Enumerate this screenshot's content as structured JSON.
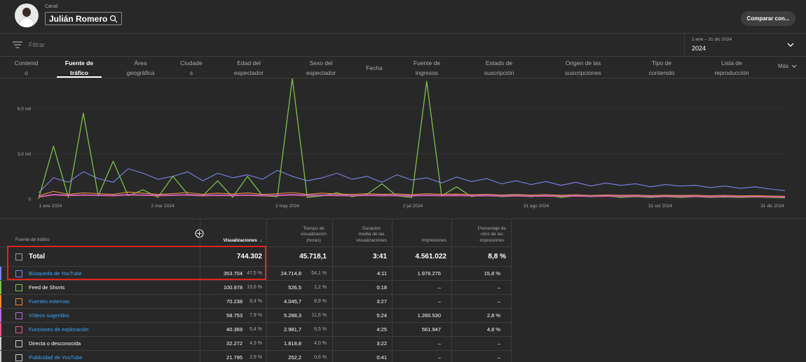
{
  "header": {
    "channel_label": "Canal",
    "channel_name": "Julián Romero",
    "compare_label": "Comparar con..."
  },
  "filter": {
    "placeholder": "Filtrar",
    "date_range": "1 ene – 31 dic 2024",
    "year": "2024"
  },
  "tabs": [
    {
      "line1": "Contenid",
      "line2": "o"
    },
    {
      "line1": "Fuente de",
      "line2": "tráfico"
    },
    {
      "line1": "Área",
      "line2": "geográfica"
    },
    {
      "line1": "Ciudade",
      "line2": "s"
    },
    {
      "line1": "Edad del",
      "line2": "espectador"
    },
    {
      "line1": "Sexo del",
      "line2": "espectador"
    },
    {
      "line1": "Fecha",
      "line2": ""
    },
    {
      "line1": "Fuente de",
      "line2": "ingresos"
    },
    {
      "line1": "Estado de",
      "line2": "suscripción"
    },
    {
      "line1": "Origen de las",
      "line2": "suscripciones"
    },
    {
      "line1": "Tipo de",
      "line2": "contenido"
    },
    {
      "line1": "Lista de",
      "line2": "reproducción"
    }
  ],
  "more_label": "Más",
  "chart_data": {
    "type": "line",
    "y_ticks": [
      "6,0 mil",
      "3,0 mil",
      "0"
    ],
    "ylim": [
      0,
      8000
    ],
    "x_ticks": [
      "1 ene 2024",
      "2 mar 2024",
      "2 may 2024",
      "2 jul 2024",
      "31 ago 2024",
      "31 oct 2024",
      "31 dic 2024"
    ],
    "series": [
      {
        "color": "#7b83eb",
        "values": [
          400,
          1400,
          1100,
          1800,
          1350,
          1100,
          2000,
          1700,
          1300,
          1500,
          1800,
          1200,
          1700,
          1400,
          1600,
          1300,
          1900,
          1500,
          1200,
          1400,
          1700,
          1300,
          1500,
          1100,
          1600,
          1250,
          1400,
          1050,
          1450,
          1150,
          1350,
          1000,
          1200,
          950,
          1150,
          900,
          1100,
          850,
          1050,
          900,
          1000,
          800,
          950,
          850,
          900,
          750,
          850,
          700,
          800,
          650,
          550
        ]
      },
      {
        "color": "#7cc04b",
        "values": [
          0,
          3500,
          100,
          5700,
          200,
          2500,
          200,
          600,
          100,
          1500,
          300,
          200,
          1200,
          100,
          1500,
          200,
          150,
          8000,
          100,
          200,
          400,
          150,
          300,
          1000,
          200,
          100,
          7800,
          200,
          800,
          150,
          300,
          150,
          200,
          150,
          250,
          100,
          200,
          150,
          200,
          100,
          150,
          100,
          150,
          100,
          150,
          100,
          120,
          100,
          120,
          100,
          80
        ]
      },
      {
        "color": "#e8883a",
        "values": [
          200,
          500,
          300,
          400,
          350,
          300,
          450,
          380,
          300,
          350,
          420,
          300,
          380,
          320,
          400,
          300,
          350,
          420,
          300,
          380,
          320,
          300,
          350,
          300,
          330,
          280,
          350,
          300,
          320,
          280,
          300,
          260,
          290,
          250,
          280,
          240,
          270,
          230,
          260,
          240,
          250,
          220,
          240,
          230,
          240,
          210,
          230,
          200,
          220,
          190,
          170
        ]
      },
      {
        "color": "#b36dd9",
        "values": [
          150,
          300,
          250,
          280,
          260,
          240,
          300,
          280,
          250,
          270,
          300,
          240,
          270,
          250,
          280,
          240,
          260,
          300,
          250,
          270,
          260,
          240,
          270,
          250,
          260,
          230,
          270,
          240,
          260,
          230,
          250,
          220,
          240,
          210,
          230,
          200,
          220,
          200,
          210,
          190,
          200,
          180,
          190,
          180,
          190,
          170,
          180,
          160,
          170,
          150,
          140
        ]
      },
      {
        "color": "#e05a8a",
        "values": [
          100,
          250,
          200,
          230,
          210,
          190,
          240,
          220,
          200,
          210,
          230,
          190,
          210,
          200,
          220,
          190,
          200,
          240,
          190,
          210,
          200,
          190,
          210,
          190,
          200,
          180,
          210,
          190,
          200,
          180,
          190,
          170,
          180,
          160,
          170,
          160,
          170,
          150,
          160,
          150,
          160,
          140,
          150,
          140,
          150,
          130,
          140,
          130,
          140,
          120,
          110
        ]
      }
    ]
  },
  "table": {
    "source_header": "Fuente de tráfico",
    "columns": [
      {
        "key": "views",
        "label_lines": [
          "Visualizaciones"
        ]
      },
      {
        "key": "watch",
        "label_lines": [
          "Tiempo de",
          "visualización",
          "(horas)"
        ]
      },
      {
        "key": "avg",
        "label_lines": [
          "Duración",
          "media de las",
          "visualizaciones"
        ]
      },
      {
        "key": "impr",
        "label_lines": [
          "Impresiones"
        ]
      },
      {
        "key": "ctr",
        "label_lines": [
          "Porcentaje de",
          "clics de las",
          "impresiones"
        ]
      }
    ],
    "total": {
      "name": "Total",
      "views": "744.302",
      "watch": "45.718,1",
      "avg": "3:41",
      "impr": "4.561.022",
      "ctr": "8,8 %"
    },
    "rows": [
      {
        "name": "Búsqueda de YouTube",
        "link": true,
        "color": "#7b83eb",
        "views": "353.704",
        "views_pct": "47,5 %",
        "watch": "24.714,8",
        "watch_pct": "54,1 %",
        "avg": "4:11",
        "impr": "1.976.276",
        "ctr": "15,8 %"
      },
      {
        "name": "Feed de Shorts",
        "link": false,
        "color": "#7cc04b",
        "views": "100.978",
        "views_pct": "13,6 %",
        "watch": "526,5",
        "watch_pct": "1,2 %",
        "avg": "0:18",
        "impr": "–",
        "ctr": "–"
      },
      {
        "name": "Fuentes externas",
        "link": true,
        "color": "#e8883a",
        "views": "70.238",
        "views_pct": "9,4 %",
        "watch": "4.045,7",
        "watch_pct": "8,9 %",
        "avg": "3:27",
        "impr": "–",
        "ctr": "–"
      },
      {
        "name": "Vídeos sugeridos",
        "link": true,
        "color": "#b36dd9",
        "views": "58.753",
        "views_pct": "7,9 %",
        "watch": "5.288,3",
        "watch_pct": "11,6 %",
        "avg": "5:24",
        "impr": "1.260.530",
        "ctr": "2,8 %"
      },
      {
        "name": "Funciones de exploración",
        "link": true,
        "color": "#e05a8a",
        "views": "40.369",
        "views_pct": "5,4 %",
        "watch": "2.981,7",
        "watch_pct": "6,5 %",
        "avg": "4:25",
        "impr": "561.947",
        "ctr": "4,8 %"
      },
      {
        "name": "Directa o desconocida",
        "link": false,
        "color": "#cccccc",
        "views": "32.272",
        "views_pct": "4,3 %",
        "watch": "1.818,8",
        "watch_pct": "4,0 %",
        "avg": "3:22",
        "impr": "–",
        "ctr": "–"
      },
      {
        "name": "Publicidad de YouTube",
        "link": true,
        "color": "#cccccc",
        "views": "21.795",
        "views_pct": "2,9 %",
        "watch": "252,2",
        "watch_pct": "0,6 %",
        "avg": "0:41",
        "impr": "–",
        "ctr": "–"
      }
    ]
  },
  "colors": {
    "accent_link": "#3ea6ff",
    "highlight": "#e0241b",
    "background": "#282828"
  }
}
